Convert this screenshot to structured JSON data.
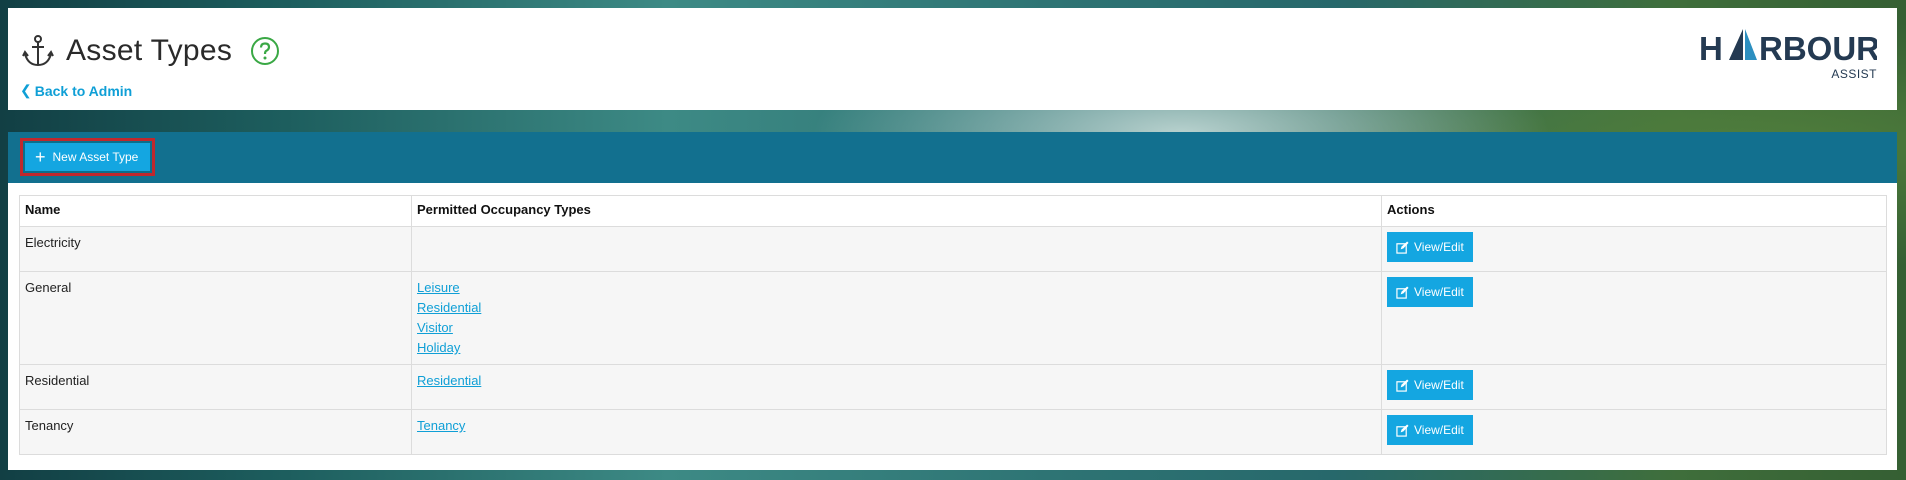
{
  "header": {
    "title": "Asset Types",
    "back_label": "Back to Admin",
    "logo": {
      "main": "HARBOUR",
      "sub": "ASSIST"
    }
  },
  "toolbar": {
    "new_label": "New Asset Type"
  },
  "table": {
    "columns": [
      "Name",
      "Permitted Occupancy Types",
      "Actions"
    ],
    "rows": [
      {
        "name": "Electricity",
        "occupancy": [],
        "action": "View/Edit"
      },
      {
        "name": "General",
        "occupancy": [
          "Leisure",
          "Residential",
          "Visitor",
          "Holiday"
        ],
        "action": "View/Edit"
      },
      {
        "name": "Residential",
        "occupancy": [
          "Residential"
        ],
        "action": "View/Edit"
      },
      {
        "name": "Tenancy",
        "occupancy": [
          "Tenancy"
        ],
        "action": "View/Edit"
      }
    ]
  },
  "colors": {
    "accent": "#14a6e1",
    "toolbar": "#12708f",
    "highlight": "#c0282d",
    "help": "#3aa845"
  },
  "icons": {
    "title": "anchor-icon",
    "help": "question-circle-icon",
    "back": "chevron-left-icon",
    "new": "plus-icon",
    "edit": "edit-icon"
  }
}
